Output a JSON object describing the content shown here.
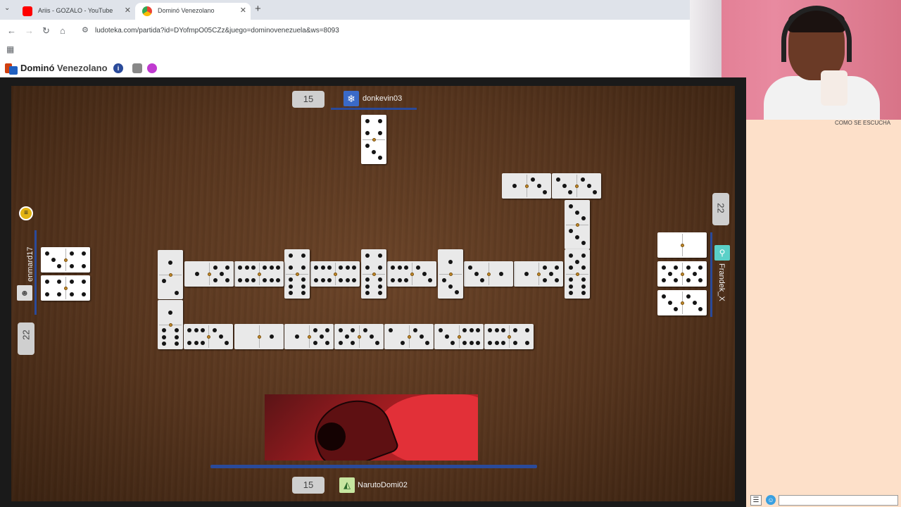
{
  "browser": {
    "tabs": [
      {
        "title": "Ariis - GOZALO - YouTube",
        "active": false,
        "favicon": "youtube-icon"
      },
      {
        "title": "Dominó Venezolano",
        "active": true,
        "favicon": "chrome-icon"
      }
    ],
    "new_tab_symbol": "+",
    "url": "ludoteka.com/partida?id=DYofmpO05CZz&juego=dominovenezuela&ws=8093"
  },
  "site": {
    "title_bold": "Dominó",
    "title_rest": "Venezolano",
    "info_symbol": "i"
  },
  "players": {
    "top": {
      "name": "donkevin03",
      "score": "15"
    },
    "left": {
      "name": "enmard17",
      "score": "22"
    },
    "right": {
      "name": "Frandek_X",
      "score": "22"
    },
    "bottom": {
      "name": "NarutoDomi02",
      "score": "15"
    }
  },
  "side_panel": {
    "caption": "COMO SE ESCUCHA"
  },
  "colors": {
    "board": "#5a381f",
    "accent_blue": "#2a4a9a",
    "side_panel": "#fde0c9"
  }
}
